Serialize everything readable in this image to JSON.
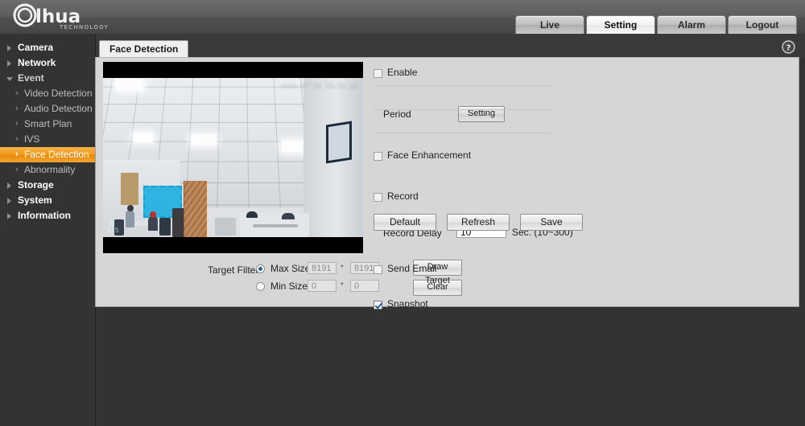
{
  "header": {
    "brand": "alhua",
    "brand_sub": "TECHNOLOGY",
    "nav": [
      {
        "label": "Live",
        "active": false
      },
      {
        "label": "Setting",
        "active": true
      },
      {
        "label": "Alarm",
        "active": false
      },
      {
        "label": "Logout",
        "active": false
      }
    ],
    "help_icon": "help-circle-icon"
  },
  "sidebar": {
    "items": [
      {
        "label": "Camera",
        "level": "top",
        "expanded": false
      },
      {
        "label": "Network",
        "level": "top",
        "expanded": false
      },
      {
        "label": "Event",
        "level": "top",
        "expanded": true
      },
      {
        "label": "Video Detection",
        "level": "sub",
        "active": false
      },
      {
        "label": "Audio Detection",
        "level": "sub",
        "active": false
      },
      {
        "label": "Smart Plan",
        "level": "sub",
        "active": false
      },
      {
        "label": "IVS",
        "level": "sub",
        "active": false
      },
      {
        "label": "Face Detection",
        "level": "sub",
        "active": true
      },
      {
        "label": "Abnormality",
        "level": "sub",
        "active": false
      },
      {
        "label": "Storage",
        "level": "top",
        "expanded": false
      },
      {
        "label": "System",
        "level": "top",
        "expanded": false
      },
      {
        "label": "Information",
        "level": "top",
        "expanded": false
      }
    ]
  },
  "tab": {
    "label": "Face Detection"
  },
  "video": {
    "osd_timestamp": "2018-07-30 15:24:01",
    "osd_corner": "1/5"
  },
  "target_filter": {
    "label": "Target Filter",
    "max_size": {
      "label": "Max Size",
      "selected": true,
      "width": "8191",
      "height": "8191",
      "separator": "*"
    },
    "min_size": {
      "label": "Min Size",
      "selected": false,
      "width": "0",
      "height": "0",
      "separator": "*"
    },
    "draw_target_label": "Draw Target",
    "clear_label": "Clear"
  },
  "settings": {
    "enable": {
      "label": "Enable",
      "checked": false
    },
    "period": {
      "label": "Period",
      "button_label": "Setting"
    },
    "face_enhancement": {
      "label": "Face Enhancement",
      "checked": false
    },
    "record": {
      "label": "Record",
      "checked": false
    },
    "record_delay": {
      "label": "Record Delay",
      "value": "10",
      "unit": "Sec. (10~300)"
    },
    "send_email": {
      "label": "Send Email",
      "checked": false
    },
    "snapshot": {
      "label": "Snapshot",
      "checked": true
    },
    "buttons": {
      "default_label": "Default",
      "refresh_label": "Refresh",
      "save_label": "Save"
    }
  },
  "colors": {
    "accent_orange": "#ef9a1a",
    "header_dark": "#5a5a5a",
    "page_bg": "#333333",
    "panel_bg": "#d6d6d6",
    "check_blue": "#2a5d9e"
  }
}
